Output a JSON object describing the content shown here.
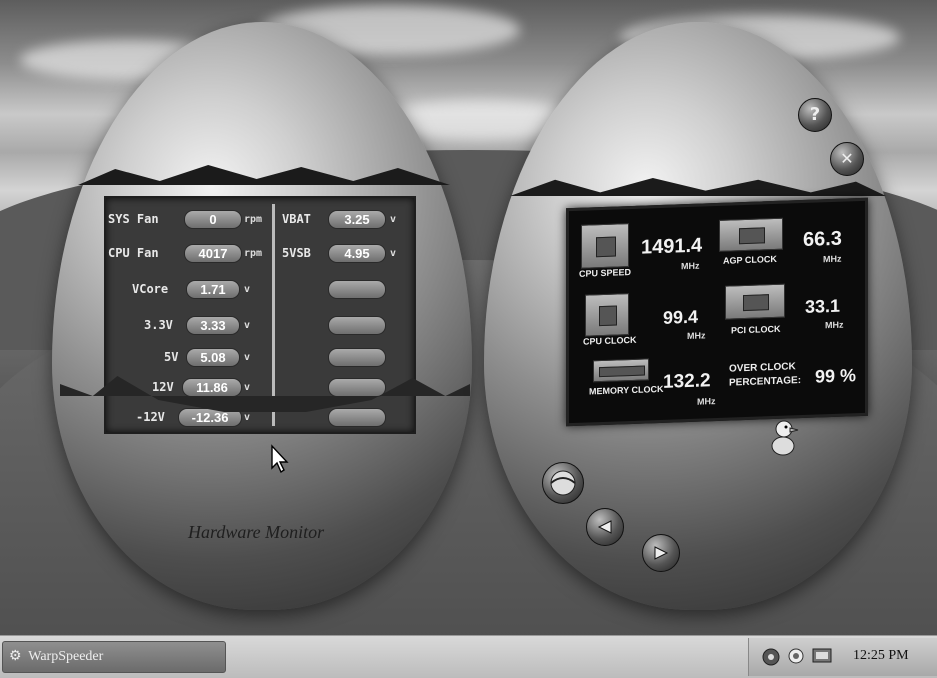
{
  "left_egg": {
    "title": "Hardware Monitor",
    "left_column": [
      {
        "label": "SYS Fan",
        "value": "0",
        "unit": "rpm"
      },
      {
        "label": "CPU Fan",
        "value": "4017",
        "unit": "rpm"
      },
      {
        "label": "VCore",
        "value": "1.71",
        "unit": "v"
      },
      {
        "label": "3.3V",
        "value": "3.33",
        "unit": "v"
      },
      {
        "label": "5V",
        "value": "5.08",
        "unit": "v"
      },
      {
        "label": "12V",
        "value": "11.86",
        "unit": "v"
      },
      {
        "label": "-12V",
        "value": "-12.36",
        "unit": "v"
      }
    ],
    "right_column": [
      {
        "label": "VBAT",
        "value": "3.25",
        "unit": "v"
      },
      {
        "label": "5VSB",
        "value": "4.95",
        "unit": "v"
      }
    ]
  },
  "right_egg": {
    "cpu_speed": {
      "caption": "CPU SPEED",
      "value": "1491.4",
      "unit": "MHz"
    },
    "agp_clock": {
      "caption": "AGP CLOCK",
      "value": "66.3",
      "unit": "MHz"
    },
    "cpu_clock": {
      "caption": "CPU CLOCK",
      "value": "99.4",
      "unit": "MHz"
    },
    "pci_clock": {
      "caption": "PCI CLOCK",
      "value": "33.1",
      "unit": "MHz"
    },
    "memory_clock": {
      "caption": "MEMORY CLOCK",
      "value": "132.2",
      "unit": "MHz"
    },
    "overclock": {
      "caption_line1": "OVER CLOCK",
      "caption_line2": "PERCENTAGE:",
      "value": "99 %"
    },
    "help_glyph": "?",
    "close_glyph": "✕"
  },
  "taskbar": {
    "task_button": "WarpSpeeder",
    "clock": "12:25 PM"
  },
  "icons": [
    "help-icon",
    "close-icon",
    "duck-icon",
    "ball-icon",
    "arrow-left-icon",
    "arrow-right-icon",
    "network-icon",
    "monitor-tray-icon",
    "warpspeeder-tray-icon",
    "cursor-icon"
  ]
}
